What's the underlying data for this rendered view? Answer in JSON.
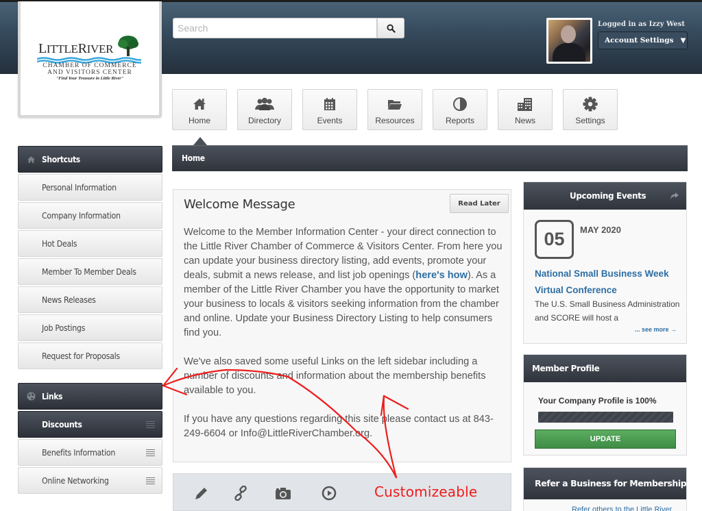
{
  "logo": {
    "name_part1": "Little",
    "name_part2": "River",
    "line1": "CHAMBER OF COMMERCE",
    "line2": "AND VISITORS CENTER",
    "tagline": "\"Find Your Treasure in Little River\""
  },
  "search": {
    "placeholder": "Search",
    "value": "",
    "icon": "search-icon"
  },
  "user": {
    "logged_in_label": "Logged in as Izzy West",
    "account_settings_label": "Account Settings",
    "account_caret": "▼"
  },
  "nav": {
    "tiles": [
      {
        "label": "Home",
        "icon": "home-icon",
        "active": true
      },
      {
        "label": "Directory",
        "icon": "users-icon"
      },
      {
        "label": "Events",
        "icon": "calendar-icon"
      },
      {
        "label": "Resources",
        "icon": "folder-icon"
      },
      {
        "label": "Reports",
        "icon": "pie-chart-icon"
      },
      {
        "label": "News",
        "icon": "building-icon"
      },
      {
        "label": "Settings",
        "icon": "gear-icon"
      }
    ]
  },
  "breadcrumb": {
    "current": "Home"
  },
  "sidebar": {
    "shortcuts": {
      "title": "Shortcuts",
      "icon": "home-icon",
      "items": [
        {
          "label": "Personal Information"
        },
        {
          "label": "Company Information"
        },
        {
          "label": "Hot Deals"
        },
        {
          "label": "Member To Member Deals"
        },
        {
          "label": "News Releases"
        },
        {
          "label": "Job Postings"
        },
        {
          "label": "Request for Proposals"
        }
      ]
    },
    "links": {
      "title": "Links",
      "icon": "globe-icon",
      "items": [
        {
          "label": "Discounts",
          "active": true
        },
        {
          "label": "Benefits Information"
        },
        {
          "label": "Online Networking"
        }
      ]
    }
  },
  "welcome": {
    "title": "Welcome Message",
    "read_later_label": "Read Later",
    "para1_a": "Welcome to the Member Information Center - your direct connection to the Little River Chamber of Commerce & Visitors Center.  From here you can update your business directory listing, add events, promote your deals, submit a news release, and list job openings (",
    "para1_link": "here's how",
    "para1_b": "). As a member of the Little River Chamber you have the opportunity to market your business to locals & visitors seeking information from the chamber and online. Update your Business Directory Listing to help consumers find you.",
    "para2": "We've also saved some useful Links on the left sidebar including a number of discounts and information about the membership benefits available to you.",
    "para3": "If you have any questions regarding this site please contact us at 843-249-6604 or Info@LittleRiverChamber.org."
  },
  "toolbar": {
    "icons": [
      "pencil-icon",
      "link-icon",
      "camera-icon",
      "play-circle-icon"
    ]
  },
  "events": {
    "title": "Upcoming Events",
    "day": "05",
    "month_year": "MAY 2020",
    "event_title": "National Small Business Week Virtual Conference",
    "description": "The U.S. Small Business Administration and SCORE will host a",
    "see_more": "... see more →"
  },
  "profile": {
    "title": "Member Profile",
    "status_text": "Your Company Profile is 100%",
    "completion_percent": 100,
    "update_label": "UPDATE"
  },
  "refer": {
    "title": "Refer a Business for Membership",
    "text": "Refer others to the Little River"
  },
  "annotation": {
    "label": "Customizeable",
    "color": "#ee1c1c"
  },
  "colors": {
    "header_top": "#4a6276",
    "header_bottom": "#25303c",
    "dark_panel": "#3a3f48",
    "link_blue": "#2d6ea3",
    "update_green": "#4a9a50"
  }
}
